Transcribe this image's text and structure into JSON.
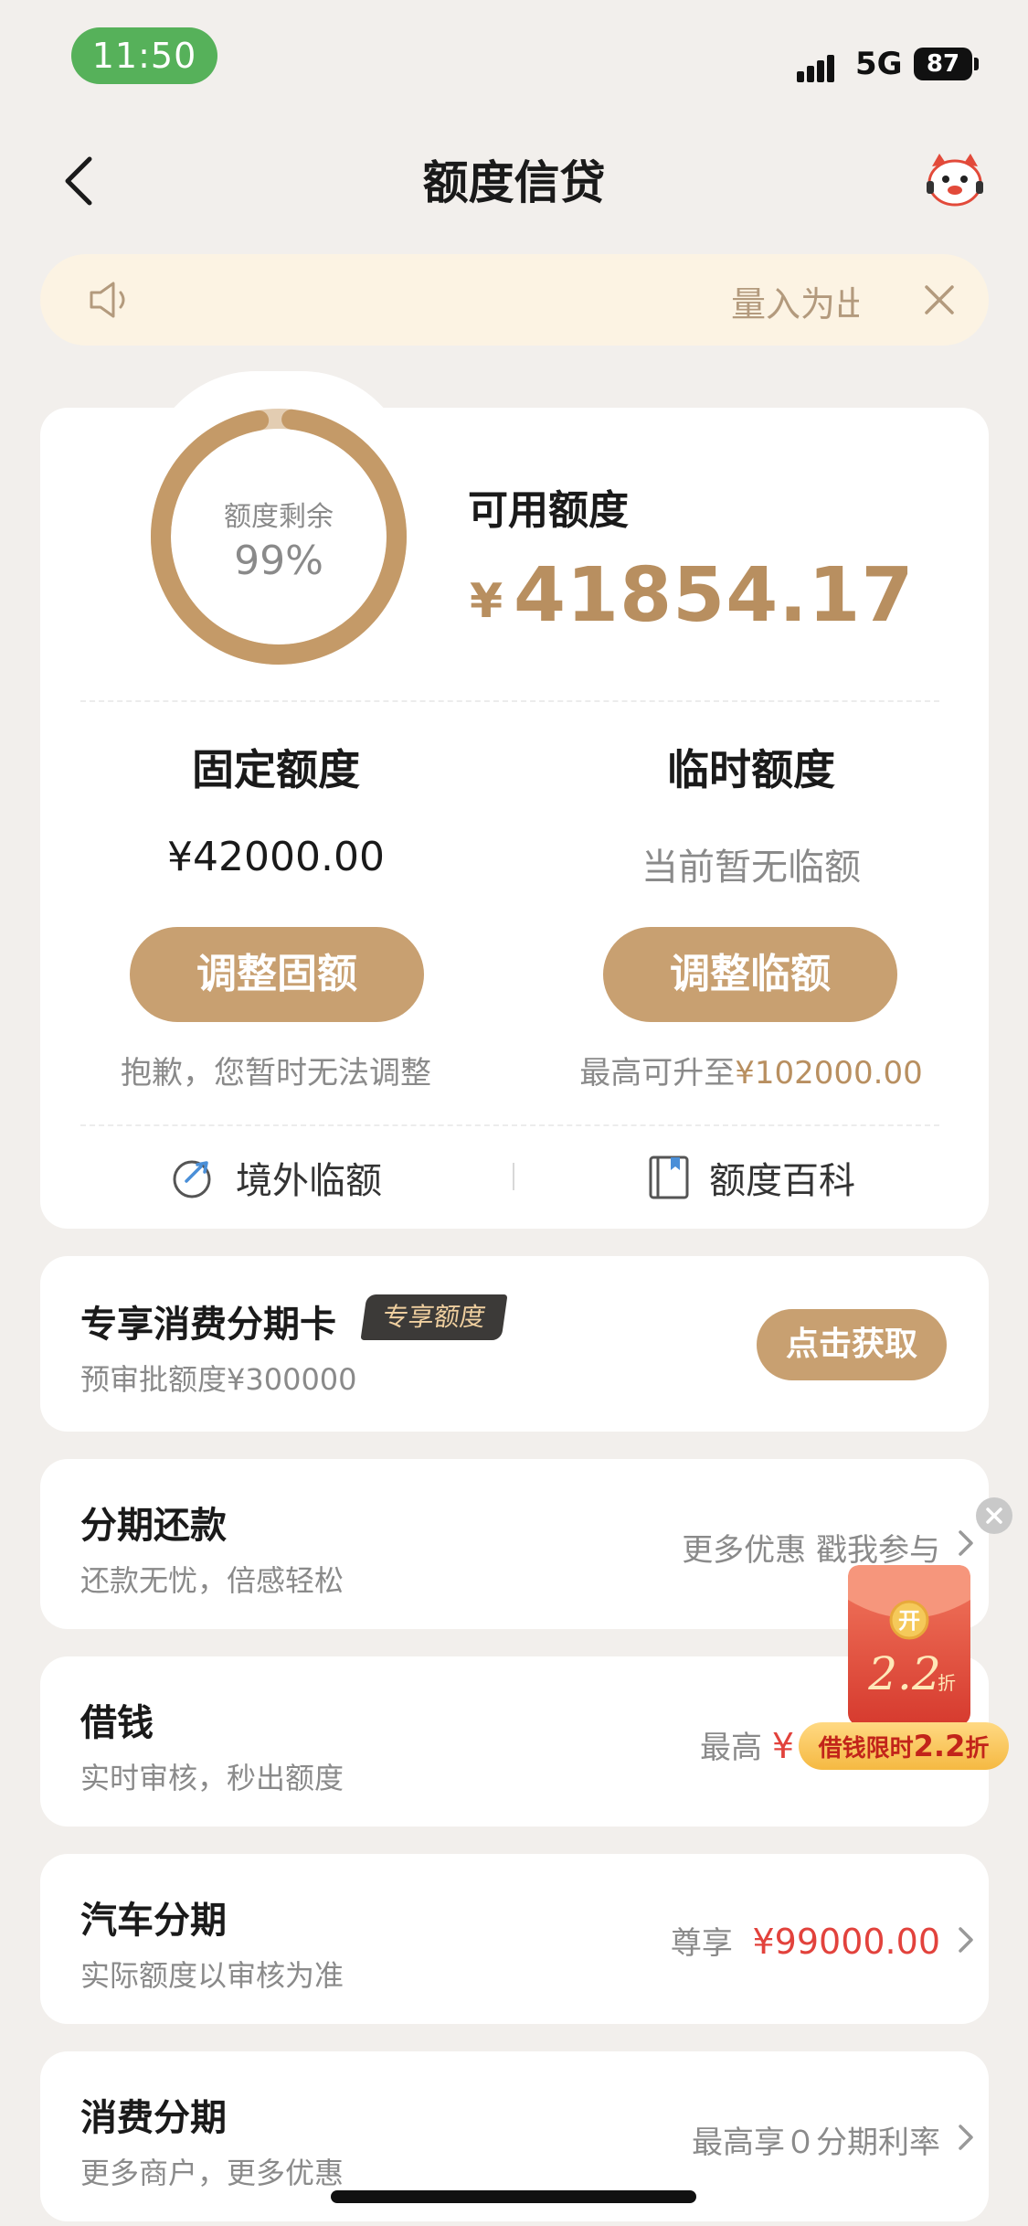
{
  "status_bar": {
    "time": "11:50",
    "network": "5G",
    "battery": "87"
  },
  "header": {
    "title": "额度信贷"
  },
  "notice": {
    "text": "量入为出"
  },
  "quota": {
    "ring_label": "额度剩余",
    "ring_percent": "99%",
    "ring_fraction": 0.99,
    "available_label": "可用额度",
    "available_currency": "¥",
    "available_amount": "41854.17",
    "fixed": {
      "title": "固定额度",
      "value": "¥42000.00",
      "button": "调整固额",
      "note": "抱歉，您暂时无法调整"
    },
    "temporary": {
      "title": "临时额度",
      "value": "当前暂无临额",
      "button": "调整临额",
      "note_prefix": "最高可升至",
      "note_amount": "¥102000.00"
    },
    "links": {
      "overseas": "境外临额",
      "wiki": "额度百科"
    }
  },
  "promo_card": {
    "title": "专享消费分期卡",
    "badge": "专享额度",
    "sub": "预审批额度¥300000",
    "button": "点击获取"
  },
  "list": [
    {
      "title": "分期还款",
      "sub": "还款无忧，倍感轻松",
      "right": "更多优惠 戳我参与",
      "highlight": ""
    },
    {
      "title": "借钱",
      "sub": "实时审核，秒出额度",
      "right": "最高",
      "highlight": "¥"
    },
    {
      "title": "汽车分期",
      "sub": "实际额度以审核为准",
      "right": "尊享",
      "highlight": "¥99000.00"
    },
    {
      "title": "消费分期",
      "sub": "更多商户，更多优惠",
      "right": "最高享０分期利率",
      "highlight": ""
    }
  ],
  "floating_packet": {
    "seal": "开",
    "discount": "2.2",
    "unit": "折",
    "banner_prefix": "借钱限时",
    "banner_value": "2.2",
    "banner_unit": "折"
  },
  "colors": {
    "gold": "#c8a071",
    "amount": "#b88f60",
    "red": "#e2423c",
    "notice_bg": "#fcf3e3"
  }
}
